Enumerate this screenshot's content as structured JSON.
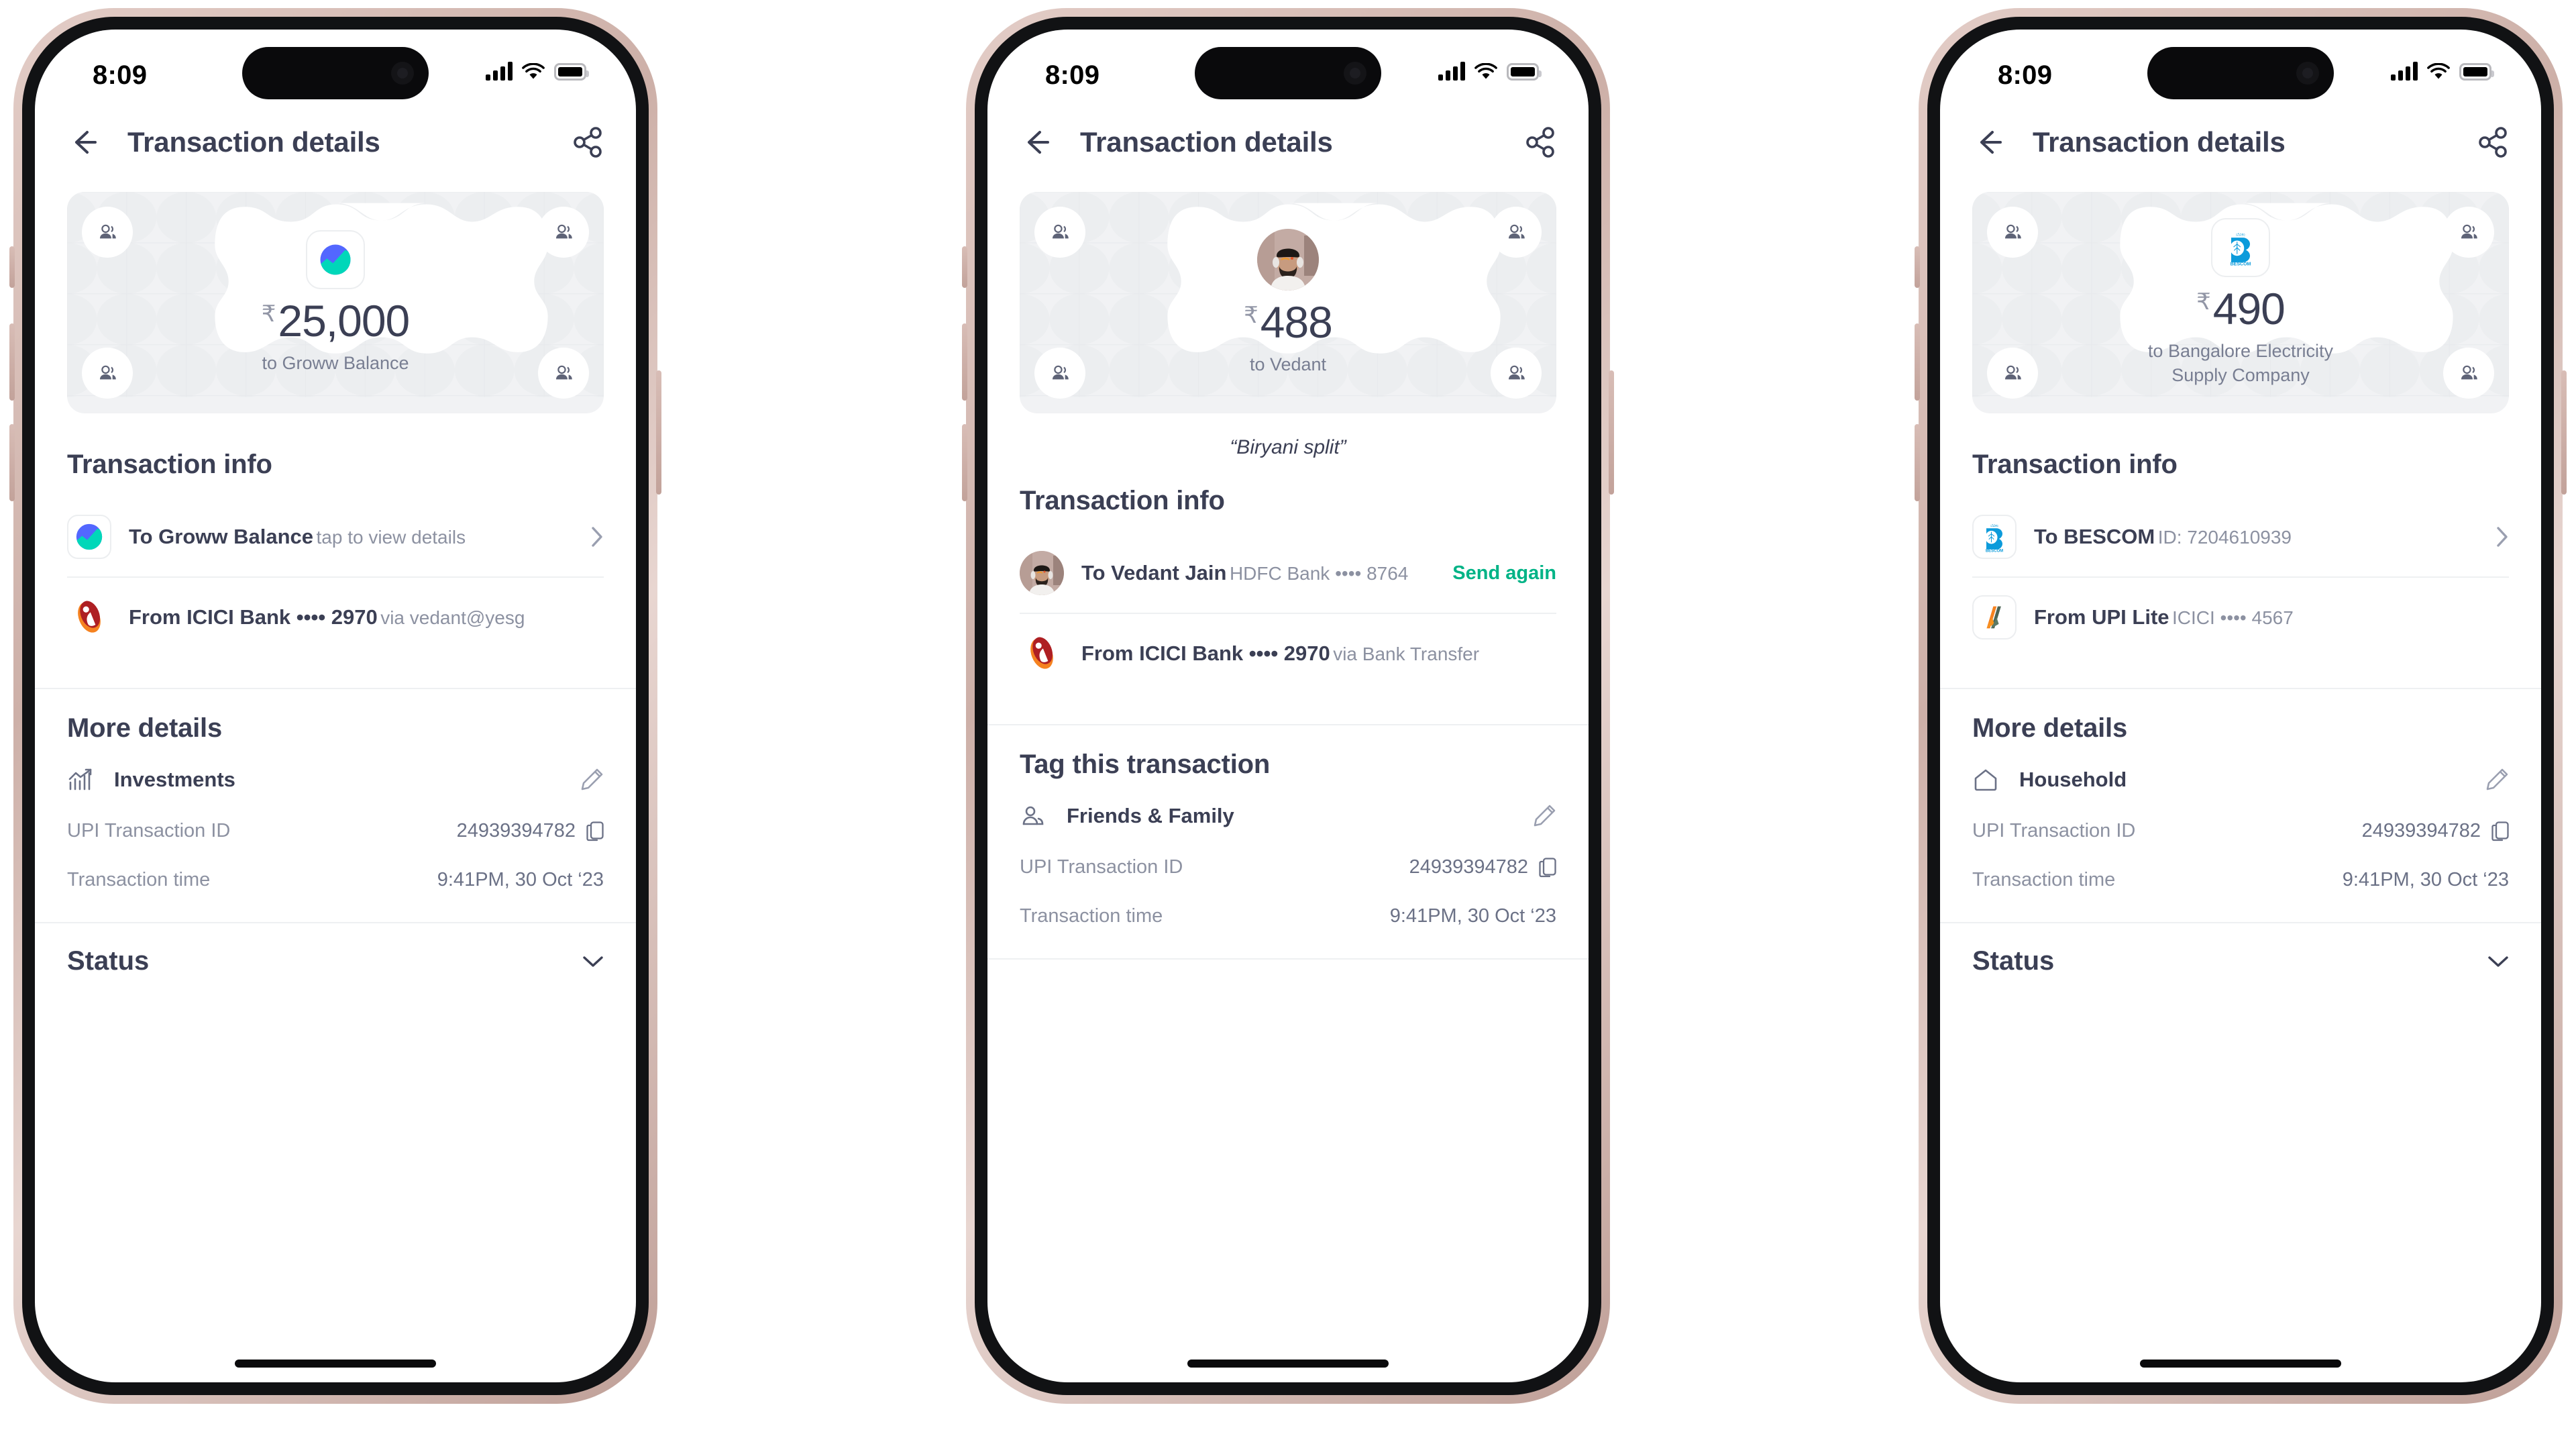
{
  "status_bar": {
    "time": "8:09",
    "signal_icon": "cellular-signal-icon",
    "wifi_icon": "wifi-icon",
    "battery_icon": "battery-icon"
  },
  "nav": {
    "title": "Transaction details",
    "back_icon": "back-arrow-icon",
    "share_icon": "share-icon"
  },
  "labels": {
    "transaction_info": "Transaction info",
    "more_details": "More details",
    "tag_this_transaction": "Tag this transaction",
    "status": "Status",
    "upi_txn_id_key": "UPI Transaction ID",
    "txn_time_key": "Transaction time"
  },
  "colors": {
    "accent_green": "#00b386",
    "text_primary": "#3b3f54",
    "text_secondary": "#8c91a1",
    "card_bg": "#f1f2f4",
    "frame_rim": "#cdb0a8"
  },
  "phones": [
    {
      "id": "phone-groww-balance",
      "hero": {
        "logo": "groww-logo",
        "currency": "₹",
        "amount": "25,000",
        "subtitle": "to Groww Balance"
      },
      "note": null,
      "transaction_info": [
        {
          "icon": "groww-logo",
          "title": "To Groww Balance",
          "subtitle": "tap to view details",
          "action": null,
          "chevron": true
        },
        {
          "icon": "icici-logo",
          "title": "From ICICI Bank •••• 2970",
          "subtitle": "via vedant@yesg",
          "action": null,
          "chevron": false
        }
      ],
      "tag_section": null,
      "more_details": {
        "tag_icon": "chart-growth-icon",
        "tag_label": "Investments",
        "edit_icon": "pencil-icon",
        "upi_transaction_id": "24939394782",
        "copy_icon": "copy-icon",
        "transaction_time": "9:41PM, 30 Oct ‘23"
      },
      "status": {
        "label": "Status",
        "chevron": "chevron-down-icon"
      }
    },
    {
      "id": "phone-vedant",
      "hero": {
        "logo": "user-photo-avatar",
        "currency": "₹",
        "amount": "488",
        "subtitle": "to Vedant"
      },
      "note": "“Biryani split”",
      "transaction_info": [
        {
          "icon": "user-photo-avatar",
          "title": "To Vedant Jain",
          "subtitle": "HDFC Bank •••• 8764",
          "action": "Send again",
          "chevron": false
        },
        {
          "icon": "icici-logo",
          "title": "From ICICI Bank •••• 2970",
          "subtitle": "via Bank Transfer",
          "action": null,
          "chevron": false
        }
      ],
      "tag_section": {
        "heading": "Tag this transaction",
        "tag_icon": "people-icon",
        "tag_label": "Friends & Family",
        "edit_icon": "pencil-icon"
      },
      "more_details": {
        "upi_transaction_id": "24939394782",
        "copy_icon": "copy-icon",
        "transaction_time": "9:41PM, 30 Oct ‘23"
      },
      "status": null
    },
    {
      "id": "phone-bescom",
      "hero": {
        "logo": "bescom-logo",
        "currency": "₹",
        "amount": "490",
        "subtitle": "to Bangalore Electricity Supply Company"
      },
      "note": null,
      "transaction_info": [
        {
          "icon": "bescom-logo",
          "title": "To BESCOM",
          "subtitle": "ID: 7204610939",
          "action": null,
          "chevron": true
        },
        {
          "icon": "upi-lite-logo",
          "title": "From UPI Lite",
          "subtitle": "ICICI •••• 4567",
          "action": null,
          "chevron": false
        }
      ],
      "tag_section": null,
      "more_details": {
        "tag_icon": "home-icon",
        "tag_label": "Household",
        "edit_icon": "pencil-icon",
        "upi_transaction_id": "24939394782",
        "copy_icon": "copy-icon",
        "transaction_time": "9:41PM, 30 Oct ‘23"
      },
      "status": {
        "label": "Status",
        "chevron": "chevron-down-icon"
      }
    }
  ]
}
